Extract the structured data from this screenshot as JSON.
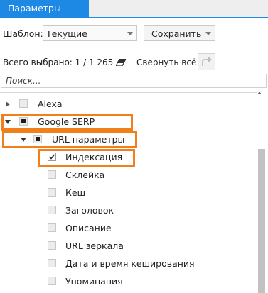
{
  "tabs": [
    {
      "label": "Параметры",
      "active": true
    }
  ],
  "template": {
    "label": "Шаблон:",
    "selected": "Текущие",
    "save_label": "Сохранить"
  },
  "summary": {
    "text": "Всего выбрано: 1 / 1 265",
    "collapse_label": "Свернуть всё"
  },
  "search": {
    "placeholder": "Поиск..."
  },
  "tree": {
    "alexa": {
      "label": "Alexa",
      "expanded": false,
      "checked": false
    },
    "google": {
      "label": "Google SERP",
      "expanded": true,
      "state": "partial"
    },
    "url_params": {
      "label": "URL параметры",
      "expanded": true,
      "state": "partial"
    },
    "leaves": [
      {
        "label": "Индексация",
        "checked": true
      },
      {
        "label": "Склейка",
        "checked": false
      },
      {
        "label": "Кеш",
        "checked": false
      },
      {
        "label": "Заголовок",
        "checked": false
      },
      {
        "label": "Описание",
        "checked": false
      },
      {
        "label": "URL зеркала",
        "checked": false
      },
      {
        "label": "Дата и время кеширования",
        "checked": false
      },
      {
        "label": "Упоминания",
        "checked": false
      }
    ]
  },
  "colors": {
    "accent": "#1e88e5",
    "highlight": "#f07f1c"
  },
  "icons": [
    "eraser-icon",
    "redo-icon",
    "expand-arrow-icon",
    "collapse-arrow-icon",
    "checkmark-icon"
  ]
}
